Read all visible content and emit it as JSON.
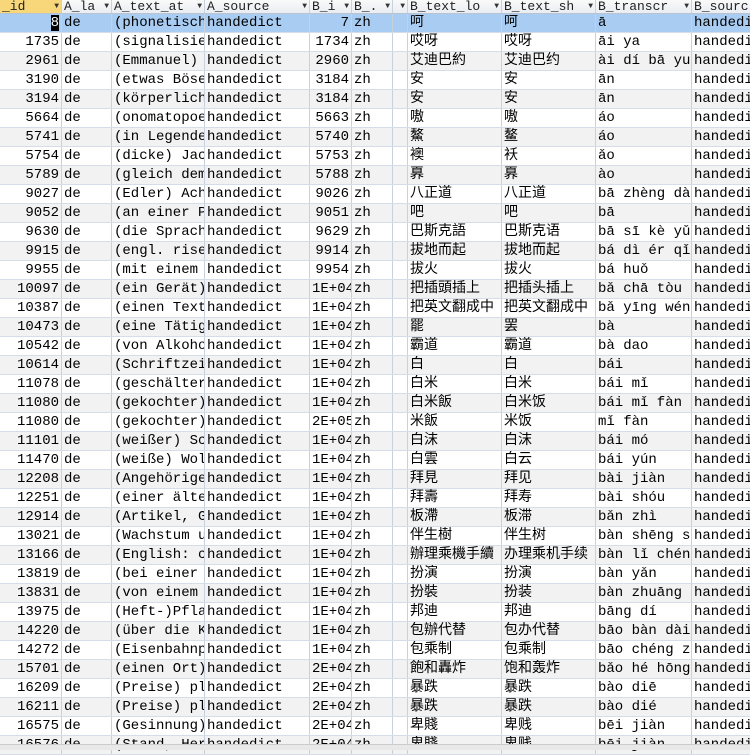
{
  "columns": [
    "_id",
    "A_la",
    "A_text_at",
    "A_source",
    "B_i",
    "B_.",
    "",
    "B_text_lo",
    "B_text_sh",
    "B_transcr",
    "B_sourc"
  ],
  "rows": [
    [
      "8",
      "de",
      "(phonetisch",
      "handedict",
      "7",
      "zh",
      "",
      "呵",
      "呵",
      "ā",
      "handedi"
    ],
    [
      "1735",
      "de",
      "(signalisie",
      "handedict",
      "1734",
      "zh",
      "",
      "哎呀",
      "哎呀",
      "āi ya",
      "handedi"
    ],
    [
      "2961",
      "de",
      "(Emmanuel) .",
      "handedict",
      "2960",
      "zh",
      "",
      "艾迪巴約",
      "艾迪巴约",
      "ài dí bā yu",
      "handedi"
    ],
    [
      "3190",
      "de",
      "(etwas Böse",
      "handedict",
      "3184",
      "zh",
      "",
      "安",
      "安",
      "ān",
      "handedi"
    ],
    [
      "3194",
      "de",
      "(körperlich",
      "handedict",
      "3184",
      "zh",
      "",
      "安",
      "安",
      "ān",
      "handedi"
    ],
    [
      "5664",
      "de",
      "(onomatopoe",
      "handedict",
      "5663",
      "zh",
      "",
      "嗷",
      "嗷",
      "áo",
      "handedi"
    ],
    [
      "5741",
      "de",
      "(in Legende",
      "handedict",
      "5740",
      "zh",
      "",
      "鰲",
      "鳌",
      "áo",
      "handedi"
    ],
    [
      "5754",
      "de",
      "(dicke) Jac",
      "handedict",
      "5753",
      "zh",
      "",
      "襖",
      "袄",
      "ǎo",
      "handedi"
    ],
    [
      "5789",
      "de",
      "(gleich dem",
      "handedict",
      "5788",
      "zh",
      "",
      "奡",
      "奡",
      "ào",
      "handedi"
    ],
    [
      "9027",
      "de",
      "(Edler) Ach",
      "handedict",
      "9026",
      "zh",
      "",
      "八正道",
      "八正道",
      "bā zhèng dà",
      "handedi"
    ],
    [
      "9052",
      "de",
      "(an einer P",
      "handedict",
      "9051",
      "zh",
      "",
      "吧",
      "吧",
      "bā",
      "handedi"
    ],
    [
      "9630",
      "de",
      "(die Sprach",
      "handedict",
      "9629",
      "zh",
      "",
      "巴斯克語",
      "巴斯克语",
      "bā sī kè yǔ",
      "handedi"
    ],
    [
      "9915",
      "de",
      "(engl. rise",
      "handedict",
      "9914",
      "zh",
      "",
      "拔地而起",
      "拔地而起",
      "bá dì ér qǐ",
      "handedi"
    ],
    [
      "9955",
      "de",
      "(mit einem .",
      "handedict",
      "9954",
      "zh",
      "",
      "拔火",
      "拔火",
      "bá huǒ",
      "handedi"
    ],
    [
      "10097",
      "de",
      "(ein Gerät)",
      "handedict",
      "1E+04",
      "zh",
      "",
      "把插頭插上",
      "把插头插上",
      "bǎ chā tòu",
      "handedi"
    ],
    [
      "10387",
      "de",
      "(einen Text",
      "handedict",
      "1E+04",
      "zh",
      "",
      "把英文翻成中",
      "把英文翻成中",
      "bǎ yīng wén",
      "handedi"
    ],
    [
      "10473",
      "de",
      "(eine Tätig",
      "handedict",
      "1E+04",
      "zh",
      "",
      "罷",
      "罢",
      "bà",
      "handedi"
    ],
    [
      "10542",
      "de",
      "(von Alkoho",
      "handedict",
      "1E+04",
      "zh",
      "",
      "霸道",
      "霸道",
      "bà dao",
      "handedi"
    ],
    [
      "10614",
      "de",
      "(Schriftzei",
      "handedict",
      "1E+04",
      "zh",
      "",
      "白",
      "白",
      "bái",
      "handedi"
    ],
    [
      "11078",
      "de",
      "(geschälter",
      "handedict",
      "1E+04",
      "zh",
      "",
      "白米",
      "白米",
      "bái mǐ",
      "handedi"
    ],
    [
      "11080",
      "de",
      "(gekochter)",
      "handedict",
      "1E+04",
      "zh",
      "",
      "白米飯",
      "白米饭",
      "bái mǐ fàn",
      "handedi"
    ],
    [
      "11080",
      "de",
      "(gekochter)",
      "handedict",
      "2E+05",
      "zh",
      "",
      "米飯",
      "米饭",
      "mǐ fàn",
      "handedi"
    ],
    [
      "11101",
      "de",
      "(weißer) Sc",
      "handedict",
      "1E+04",
      "zh",
      "",
      "白沫",
      "白沫",
      "bái mó",
      "handedi"
    ],
    [
      "11470",
      "de",
      "(weiße) Wol",
      "handedict",
      "1E+04",
      "zh",
      "",
      "白雲",
      "白云",
      "bái yún",
      "handedi"
    ],
    [
      "12208",
      "de",
      "(Angehörige",
      "handedict",
      "1E+04",
      "zh",
      "",
      "拜見",
      "拜见",
      "bài jiàn",
      "handedi"
    ],
    [
      "12251",
      "de",
      "(einer älte",
      "handedict",
      "1E+04",
      "zh",
      "",
      "拜壽",
      "拜寿",
      "bài shóu",
      "handedi"
    ],
    [
      "12914",
      "de",
      "(Artikel, G",
      "handedict",
      "1E+04",
      "zh",
      "",
      "板滯",
      "板滞",
      "bǎn zhì",
      "handedi"
    ],
    [
      "13021",
      "de",
      "(Wachstum u",
      "handedict",
      "1E+04",
      "zh",
      "",
      "伴生樹",
      "伴生树",
      "bàn shēng s",
      "handedi"
    ],
    [
      "13166",
      "de",
      "(English: c",
      "handedict",
      "1E+04",
      "zh",
      "",
      "辦理乘機手續",
      "办理乘机手续",
      "bàn lǐ chén",
      "handedi"
    ],
    [
      "13819",
      "de",
      "(bei einer",
      "handedict",
      "1E+04",
      "zh",
      "",
      "扮演",
      "扮演",
      "bàn yǎn",
      "handedi"
    ],
    [
      "13831",
      "de",
      "(von einem",
      "handedict",
      "1E+04",
      "zh",
      "",
      "扮裝",
      "扮装",
      "bàn zhuāng",
      "handedi"
    ],
    [
      "13975",
      "de",
      "(Heft-)Pfla",
      "handedict",
      "1E+04",
      "zh",
      "",
      "邦迪",
      "邦迪",
      "bāng dí",
      "handedi"
    ],
    [
      "14220",
      "de",
      "(über die K",
      "handedict",
      "1E+04",
      "zh",
      "",
      "包辦代替",
      "包办代替",
      "bāo bàn dài",
      "handedi"
    ],
    [
      "14272",
      "de",
      "(Eisenbahnp",
      "handedict",
      "1E+04",
      "zh",
      "",
      "包乘制",
      "包乘制",
      "bāo chéng z",
      "handedi"
    ],
    [
      "15701",
      "de",
      "(einen Ort)",
      "handedict",
      "2E+04",
      "zh",
      "",
      "飽和轟炸",
      "饱和轰炸",
      "bǎo hé hōng",
      "handedi"
    ],
    [
      "16209",
      "de",
      "(Preise) pl",
      "handedict",
      "2E+04",
      "zh",
      "",
      "暴跌",
      "暴跌",
      "bào diē",
      "handedi"
    ],
    [
      "16211",
      "de",
      "(Preise) pl",
      "handedict",
      "2E+04",
      "zh",
      "",
      "暴跌",
      "暴跌",
      "bào dié",
      "handedi"
    ],
    [
      "16575",
      "de",
      "(Gesinnung)",
      "handedict",
      "2E+04",
      "zh",
      "",
      "卑賤",
      "卑贱",
      "bēi jiàn",
      "handedi"
    ],
    [
      "16576",
      "de",
      "(Stand, Her",
      "handedict",
      "2E+04",
      "zh",
      "",
      "卑賤",
      "卑贱",
      "bēi jiàn",
      "handedi"
    ]
  ],
  "colors": {
    "selected_row": "#a9cdf2",
    "alt_row": "#f2f2f2",
    "active_header": "#f7d77a"
  }
}
